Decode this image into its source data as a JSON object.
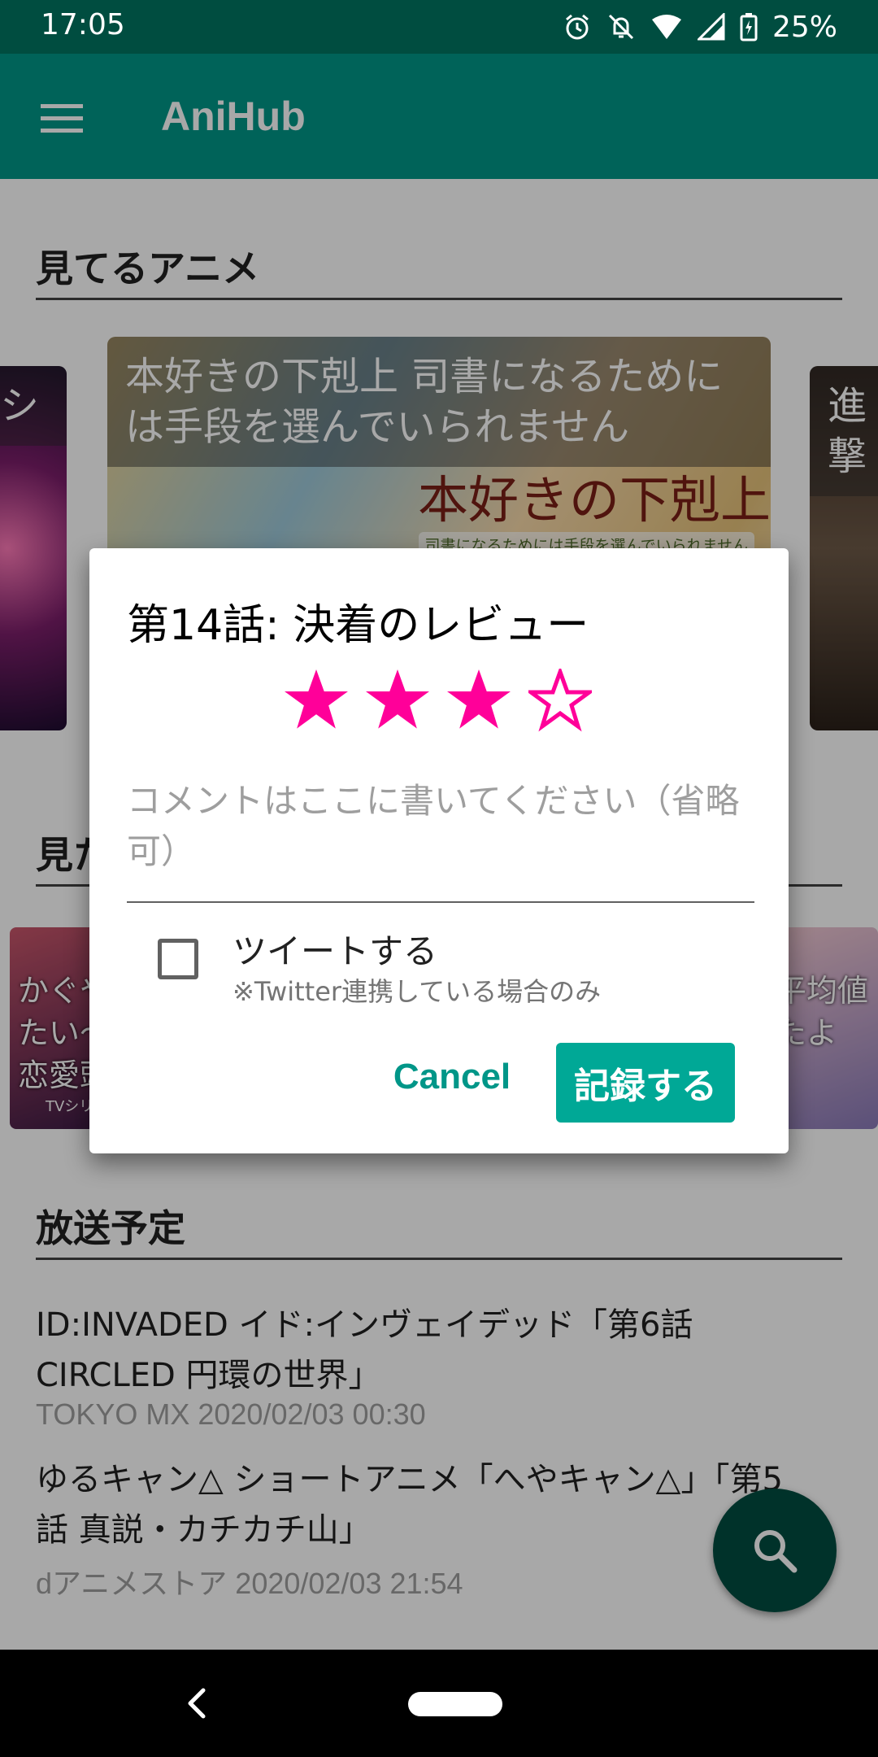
{
  "status_bar": {
    "time": "17:05",
    "battery": "25%",
    "icons": [
      "alarm-icon",
      "mute-icon",
      "wifi-icon",
      "signal-icon",
      "battery-icon"
    ]
  },
  "app_bar": {
    "title": "AniHub",
    "menu_icon": "hamburger-menu-icon"
  },
  "sections": {
    "watching": {
      "heading": "見てるアニメ",
      "main_card_title": "本好きの下剋上 司書になるためには手段を選んでいられません",
      "main_card_art_title": "本好きの下剋上",
      "main_card_art_subtitle": "司書になるためには手段を選んでいられません",
      "left_card_fragment": "シ",
      "right_card_fragment": "進撃"
    },
    "watched": {
      "heading_fragment": "見た",
      "left_card_text": "かぐや\nたい〜\n恋愛頭",
      "left_card_small": "TVシリ",
      "right_card_text": "平均値\nたよ"
    },
    "broadcast": {
      "heading": "放送予定",
      "items": [
        {
          "title": "ID:INVADED イド:インヴェイデッド「第6話 CIRCLED 円環の世界」",
          "subtitle": "TOKYO MX 2020/02/03 00:30"
        },
        {
          "title": "ゆるキャン△ ショートアニメ「へやキャン△」「第5話 真説・カチカチ山」",
          "subtitle": "dアニメストア 2020/02/03 21:54"
        }
      ]
    }
  },
  "dialog": {
    "title": "第14話: 決着のレビュー",
    "rating": 3,
    "rating_max": 4,
    "star_color": "#ff0099",
    "comment_placeholder": "コメントはここに書いてください（省略可）",
    "tweet_label": "ツイートする",
    "tweet_note": "※Twitter連携している場合のみ",
    "tweet_checked": false,
    "cancel_label": "Cancel",
    "save_label": "記録する"
  },
  "fab": {
    "icon": "search-icon"
  },
  "nav_bar": {
    "back_icon": "back-chevron-icon",
    "home_icon": "home-pill-icon"
  },
  "colors": {
    "status_bar": "#004d40",
    "app_bar": "#009688",
    "accent": "#009688",
    "button": "#00a896"
  }
}
